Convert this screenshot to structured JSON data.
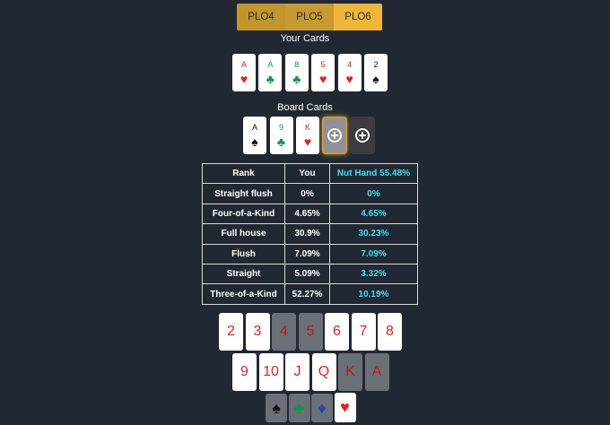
{
  "tabs": [
    {
      "label": "PLO4",
      "selected": false
    },
    {
      "label": "PLO5",
      "selected": false
    },
    {
      "label": "PLO6",
      "selected": true
    }
  ],
  "your_cards_title": "Your Cards",
  "your_cards": [
    {
      "rank": "A",
      "suit": "♥",
      "color": "red"
    },
    {
      "rank": "A",
      "suit": "♣",
      "color": "green"
    },
    {
      "rank": "8",
      "suit": "♣",
      "color": "green"
    },
    {
      "rank": "5",
      "suit": "♥",
      "color": "red"
    },
    {
      "rank": "4",
      "suit": "♥",
      "color": "red"
    },
    {
      "rank": "2",
      "suit": "♠",
      "color": "black"
    }
  ],
  "board_title": "Board Cards",
  "board_cards": [
    {
      "rank": "A",
      "suit": "♠",
      "color": "black"
    },
    {
      "rank": "9",
      "suit": "♣",
      "color": "green"
    },
    {
      "rank": "K",
      "suit": "♥",
      "color": "red"
    }
  ],
  "table": {
    "headers": [
      "Rank",
      "You",
      "Nut Hand 55.48%"
    ],
    "rows": [
      [
        "Straight flush",
        "0%",
        "0%"
      ],
      [
        "Four-of-a-Kind",
        "4.65%",
        "4.65%"
      ],
      [
        "Full house",
        "30.9%",
        "30.23%"
      ],
      [
        "Flush",
        "7.09%",
        "7.09%"
      ],
      [
        "Straight",
        "5.09%",
        "3.32%"
      ],
      [
        "Three-of-a-Kind",
        "52.27%",
        "10.19%"
      ]
    ]
  },
  "rank_row1": [
    {
      "label": "2",
      "enabled": true
    },
    {
      "label": "3",
      "enabled": true
    },
    {
      "label": "4",
      "enabled": false
    },
    {
      "label": "5",
      "enabled": false
    },
    {
      "label": "6",
      "enabled": true
    },
    {
      "label": "7",
      "enabled": true
    },
    {
      "label": "8",
      "enabled": true
    }
  ],
  "rank_row2": [
    {
      "label": "9",
      "enabled": true
    },
    {
      "label": "10",
      "enabled": true
    },
    {
      "label": "J",
      "enabled": true
    },
    {
      "label": "Q",
      "enabled": true
    },
    {
      "label": "K",
      "enabled": false
    },
    {
      "label": "A",
      "enabled": false
    }
  ],
  "suits": [
    {
      "symbol": "♠",
      "name": "spade",
      "color": "black",
      "selected": false
    },
    {
      "symbol": "♣",
      "name": "club",
      "color": "green",
      "selected": false
    },
    {
      "symbol": "♦",
      "name": "diamond",
      "color": "blue",
      "selected": false
    },
    {
      "symbol": "♥",
      "name": "heart",
      "color": "red",
      "selected": true
    }
  ],
  "colors": {
    "background": "#222833",
    "accent": "#f0b63c",
    "nut_text": "#3fe0e8",
    "red_suit": "#e2231a",
    "green_suit": "#17954a"
  }
}
